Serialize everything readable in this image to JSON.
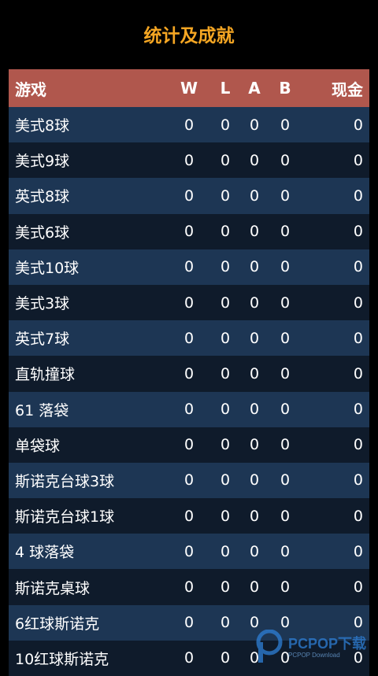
{
  "page_title": "统计及成就",
  "table": {
    "headers": {
      "name": "游戏",
      "w": "W",
      "l": "L",
      "a": "A",
      "b": "B",
      "cash": "现金"
    },
    "rows": [
      {
        "name": "美式8球",
        "w": "0",
        "l": "0",
        "a": "0",
        "b": "0",
        "cash": "0"
      },
      {
        "name": "美式9球",
        "w": "0",
        "l": "0",
        "a": "0",
        "b": "0",
        "cash": "0"
      },
      {
        "name": "英式8球",
        "w": "0",
        "l": "0",
        "a": "0",
        "b": "0",
        "cash": "0"
      },
      {
        "name": "美式6球",
        "w": "0",
        "l": "0",
        "a": "0",
        "b": "0",
        "cash": "0"
      },
      {
        "name": "美式10球",
        "w": "0",
        "l": "0",
        "a": "0",
        "b": "0",
        "cash": "0"
      },
      {
        "name": "美式3球",
        "w": "0",
        "l": "0",
        "a": "0",
        "b": "0",
        "cash": "0"
      },
      {
        "name": "英式7球",
        "w": "0",
        "l": "0",
        "a": "0",
        "b": "0",
        "cash": "0"
      },
      {
        "name": "直轨撞球",
        "w": "0",
        "l": "0",
        "a": "0",
        "b": "0",
        "cash": "0"
      },
      {
        "name": "61 落袋",
        "w": "0",
        "l": "0",
        "a": "0",
        "b": "0",
        "cash": "0"
      },
      {
        "name": "单袋球",
        "w": "0",
        "l": "0",
        "a": "0",
        "b": "0",
        "cash": "0"
      },
      {
        "name": "斯诺克台球3球",
        "w": "0",
        "l": "0",
        "a": "0",
        "b": "0",
        "cash": "0"
      },
      {
        "name": "斯诺克台球1球",
        "w": "0",
        "l": "0",
        "a": "0",
        "b": "0",
        "cash": "0"
      },
      {
        "name": "4 球落袋",
        "w": "0",
        "l": "0",
        "a": "0",
        "b": "0",
        "cash": "0"
      },
      {
        "name": "斯诺克桌球",
        "w": "0",
        "l": "0",
        "a": "0",
        "b": "0",
        "cash": "0"
      },
      {
        "name": "6红球斯诺克",
        "w": "0",
        "l": "0",
        "a": "0",
        "b": "0",
        "cash": "0"
      },
      {
        "name": "10红球斯诺克",
        "w": "0",
        "l": "0",
        "a": "0",
        "b": "0",
        "cash": "0"
      }
    ]
  },
  "watermark": {
    "text": "PCPOP下载",
    "sub": "PCPOP Download",
    "color": "#2e7fd6"
  },
  "colors": {
    "title": "#f5a623",
    "header_bg": "#b0574d",
    "row_odd": "#1d3654",
    "row_even": "#0f1b2b"
  }
}
